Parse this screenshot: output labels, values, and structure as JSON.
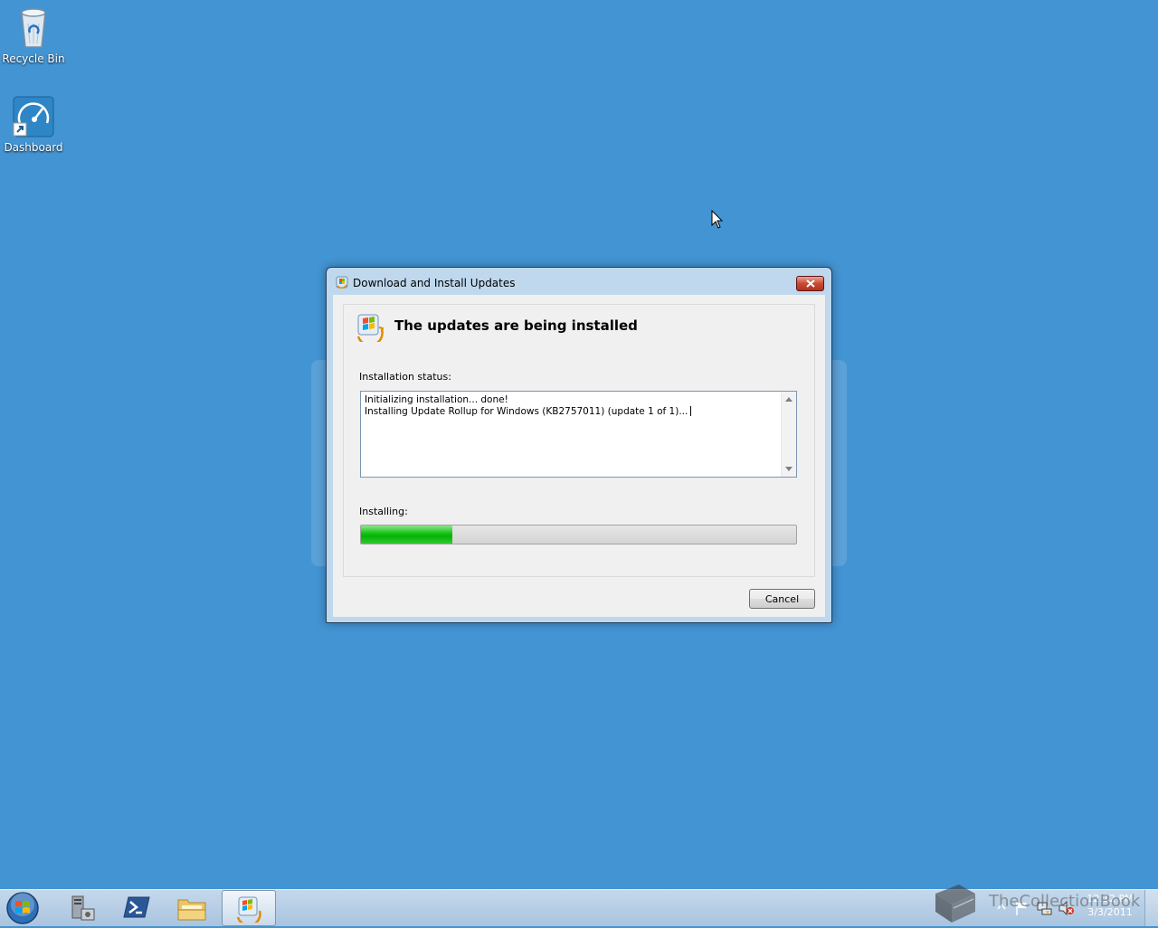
{
  "desktop": {
    "icons": [
      {
        "label": "Recycle Bin",
        "icon": "recycle-bin-icon"
      },
      {
        "label": "Dashboard",
        "icon": "dashboard-icon"
      }
    ]
  },
  "dialog": {
    "title": "Download and Install Updates",
    "heading": "The updates are being installed",
    "status_label": "Installation status:",
    "status_lines": [
      "Initializing installation... done!",
      "Installing Update Rollup for Windows (KB2757011) (update 1 of 1)..."
    ],
    "progress_label": "Installing:",
    "progress_percent": 21,
    "cancel_label": "Cancel",
    "close_icon": "close-icon"
  },
  "taskbar": {
    "buttons": [
      {
        "icon": "start-orb-icon"
      },
      {
        "icon": "server-manager-icon"
      },
      {
        "icon": "powershell-icon"
      },
      {
        "icon": "file-explorer-icon"
      },
      {
        "icon": "windows-update-icon",
        "active": true
      }
    ],
    "clock": {
      "time": "12:12 PM",
      "date": "3/3/2011"
    }
  },
  "watermark": "TheCollectionBook",
  "colors": {
    "desktop": "#4394d3",
    "progress_fill": "#0fc20f",
    "close_button": "#c94a35"
  }
}
